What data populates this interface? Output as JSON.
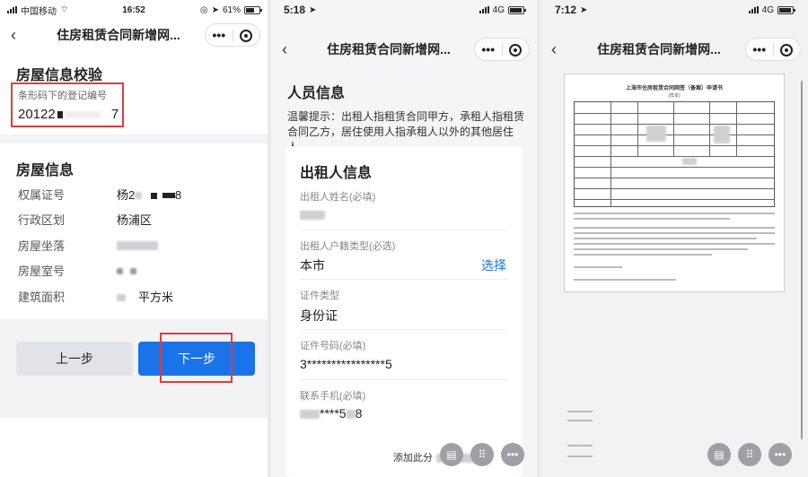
{
  "screen1": {
    "status": {
      "carrier": "中国移动",
      "time": "16:52",
      "battery": "61%"
    },
    "nav_title": "住房租赁合同新增网...",
    "verify_title": "房屋信息校验",
    "reg_label": "条形码下的登记编号",
    "reg_value_prefix": "20122",
    "reg_value_suffix": "7",
    "house_title": "房屋信息",
    "rows": [
      {
        "label": "权属证号",
        "value_prefix": "杨2",
        "value_suffix": "8"
      },
      {
        "label": "行政区划",
        "value": "杨浦区"
      },
      {
        "label": "房屋坐落",
        "value": ""
      },
      {
        "label": "房屋室号",
        "value": ""
      },
      {
        "label": "建筑面积",
        "value_suffix": "平方米"
      }
    ],
    "prev_button": "上一步",
    "next_button": "下一步"
  },
  "screen2": {
    "status": {
      "time": "5:18",
      "network": "4G"
    },
    "nav_title": "住房租赁合同新增网...",
    "title": "人员信息",
    "tip": "温馨提示：出租人指租赁合同甲方，承租人指租赁合同乙方，居住使用人指承租人以外的其他居住人。",
    "card_title": "出租人信息",
    "fields": [
      {
        "label": "出租人姓名(必填)",
        "value": ""
      },
      {
        "label": "出租人户籍类型(必选)",
        "value": "本市",
        "action": "选择"
      },
      {
        "label": "证件类型",
        "value": "身份证"
      },
      {
        "label": "证件号码(必填)",
        "value": "3****************5"
      },
      {
        "label": "联系手机(必填)",
        "value_middle": "****5",
        "value_suffix": "8"
      }
    ],
    "share_text": "添加此分"
  },
  "screen3": {
    "status": {
      "time": "7:12",
      "network": "4G"
    },
    "nav_title": "住房租赁合同新增网...",
    "doc_title": "上海市住房租赁合同网签（备案）申请书",
    "doc_sub": "(样本)"
  },
  "colors": {
    "accent": "#1a73e8",
    "highlight": "#e23b3b"
  }
}
